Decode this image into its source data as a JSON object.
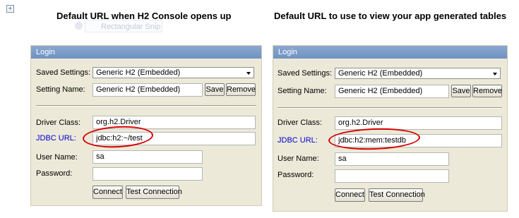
{
  "left_heading": "Default URL when H2 Console opens up",
  "right_heading": "Default URL to use to view your app generated tables",
  "ghost_text": "Rectangular Snip",
  "panels": {
    "left": {
      "header": "Login",
      "saved_settings_label": "Saved Settings:",
      "saved_settings_value": "Generic H2 (Embedded)",
      "setting_name_label": "Setting Name:",
      "setting_name_value": "Generic H2 (Embedded)",
      "save_label": "Save",
      "remove_label": "Remove",
      "driver_class_label": "Driver Class:",
      "driver_class_value": "org.h2.Driver",
      "jdbc_url_label": "JDBC URL:",
      "jdbc_url_value": "jdbc:h2:~/test",
      "user_name_label": "User Name:",
      "user_name_value": "sa",
      "password_label": "Password:",
      "password_value": "",
      "connect_label": "Connect",
      "test_connection_label": "Test Connection"
    },
    "right": {
      "header": "Login",
      "saved_settings_label": "Saved Settings:",
      "saved_settings_value": "Generic H2 (Embedded)",
      "setting_name_label": "Setting Name:",
      "setting_name_value": "Generic H2 (Embedded)",
      "save_label": "Save",
      "remove_label": "Remove",
      "driver_class_label": "Driver Class:",
      "driver_class_value": "org.h2.Driver",
      "jdbc_url_label": "JDBC URL:",
      "jdbc_url_value": "jdbc:h2:mem:testdb",
      "user_name_label": "User Name:",
      "user_name_value": "sa",
      "password_label": "Password:",
      "password_value": "",
      "connect_label": "Connect",
      "test_connection_label": "Test Connection"
    }
  },
  "colors": {
    "panel_bg": "#ece9d8",
    "header_bg": "#7b9cc8",
    "link": "#0000cc",
    "highlight_circle": "#d40000"
  }
}
